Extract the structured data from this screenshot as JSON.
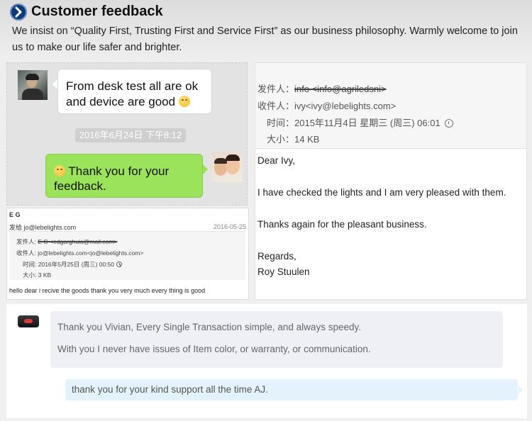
{
  "header": {
    "title": "Customer feedback",
    "intro": "We insist on “Quality First, Trusting First and Service First” as our business philosophy. Warmly welcome to join us to make our life safer and brighter."
  },
  "chat": {
    "incoming_line1": "From desk test all are ok",
    "incoming_line2": "and device are good",
    "timestamp": "2016年6月24日 下午8:12",
    "outgoing_line1": "Thank you for your",
    "outgoing_line2": "feedback."
  },
  "email_small": {
    "sender_name": "E G",
    "send_to": "发给 jo@lebelights.com",
    "date": "2016-05-25",
    "from_label": "发件人:",
    "from_value": "E G <edgarghuia@mail.com>",
    "to_label": "收件人:",
    "to_value": "jo@lebelights.com<jo@lebelights.com>",
    "time_label": "时间:",
    "time_value": "2016年5月25日 (周三) 00:50",
    "size_label": "大小:",
    "size_value": "3 KB",
    "body": "hello dear i recive the goods thank you very much every thing is good"
  },
  "email_large": {
    "from_label": "发件人：",
    "from_value": "info <info@agriledsni>",
    "to_label": "收件人：",
    "to_value": "ivy<ivy@lebelights.com>",
    "time_label": "时间：",
    "time_value": "2015年11月4日 星期三 (周三) 06:01",
    "size_label": "大小：",
    "size_value": "14 KB",
    "greeting": "Dear Ivy,",
    "line1": "I have checked the lights and I am very pleased with them.",
    "line2": "Thanks again for the pleasant business.",
    "closing": "Regards,",
    "signature": "Roy Stuulen"
  },
  "review": {
    "line1": "Thank you Vivian, Every Single Transaction simple, and always speedy.",
    "line2": "With you I never have issues of Item color, or warranty, or communication.",
    "reply": "thank you for your kind support all the time AJ."
  }
}
